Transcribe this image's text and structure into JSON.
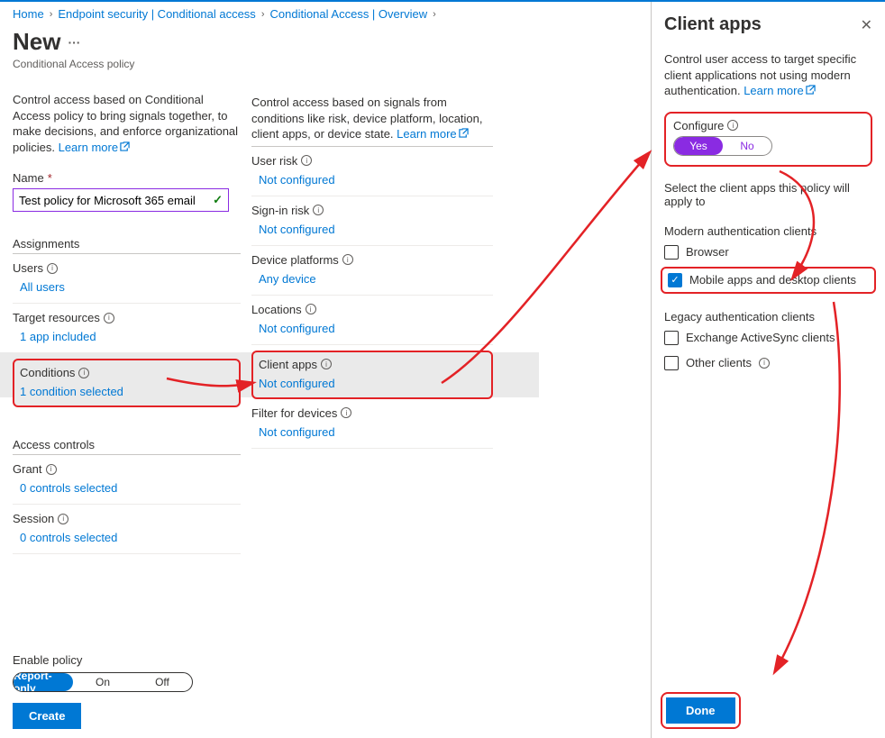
{
  "breadcrumb": [
    "Home",
    "Endpoint security | Conditional access",
    "Conditional Access | Overview"
  ],
  "page": {
    "title": "New",
    "subtitle": "Conditional Access policy"
  },
  "left": {
    "desc": "Control access based on Conditional Access policy to bring signals together, to make decisions, and enforce organizational policies.",
    "learn": "Learn more",
    "name_label": "Name",
    "name_value": "Test policy for Microsoft 365 email",
    "assignments_hdr": "Assignments",
    "users_label": "Users",
    "users_val": "All users",
    "targets_label": "Target resources",
    "targets_val": "1 app included",
    "conditions_label": "Conditions",
    "conditions_val": "1 condition selected",
    "access_hdr": "Access controls",
    "grant_label": "Grant",
    "grant_val": "0 controls selected",
    "session_label": "Session",
    "session_val": "0 controls selected"
  },
  "mid": {
    "desc": "Control access based on signals from conditions like risk, device platform, location, client apps, or device state.",
    "learn": "Learn more",
    "items": [
      {
        "label": "User risk",
        "val": "Not configured"
      },
      {
        "label": "Sign-in risk",
        "val": "Not configured"
      },
      {
        "label": "Device platforms",
        "val": "Any device"
      },
      {
        "label": "Locations",
        "val": "Not configured"
      },
      {
        "label": "Client apps",
        "val": "Not configured",
        "hl": true
      },
      {
        "label": "Filter for devices",
        "val": "Not configured"
      }
    ]
  },
  "panel": {
    "title": "Client apps",
    "desc": "Control user access to target specific client applications not using modern authentication.",
    "learn": "Learn more",
    "configure_label": "Configure",
    "yes": "Yes",
    "no": "No",
    "select_text": "Select the client apps this policy will apply to",
    "group1": "Modern authentication clients",
    "chk1": "Browser",
    "chk2": "Mobile apps and desktop clients",
    "group2": "Legacy authentication clients",
    "chk3": "Exchange ActiveSync clients",
    "chk4": "Other clients",
    "done": "Done"
  },
  "bottom": {
    "enable_label": "Enable policy",
    "opt1": "Report-only",
    "opt2": "On",
    "opt3": "Off",
    "create": "Create"
  }
}
